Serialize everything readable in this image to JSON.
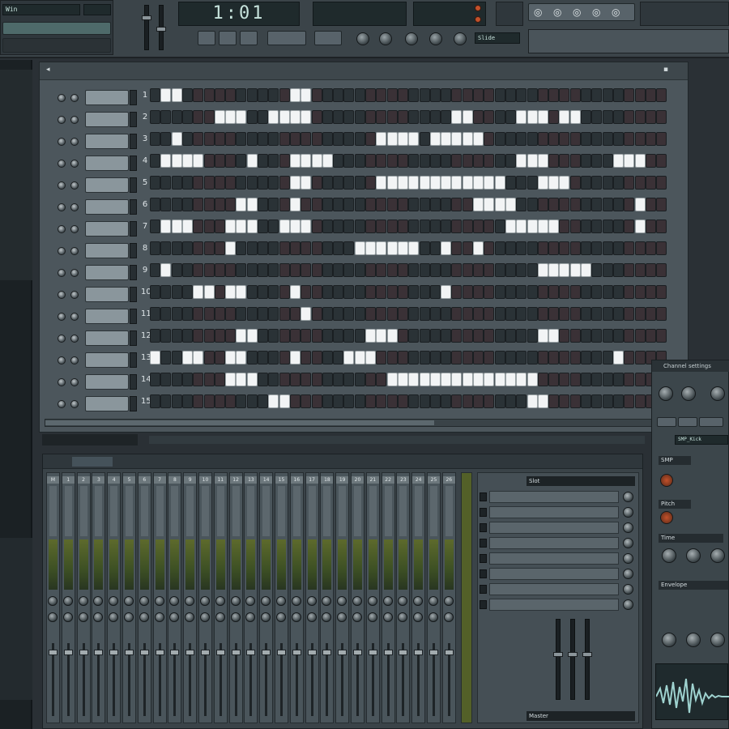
{
  "toolbar": {
    "song_title": "Win",
    "time_display": "1:01",
    "tempo_label": "",
    "pattern_label": "Slide"
  },
  "sequencer": {
    "channel_labels": [
      "",
      "",
      "",
      "",
      "",
      "",
      "",
      "",
      "",
      "",
      "",
      "",
      "",
      "",
      ""
    ],
    "rows": [
      {
        "idx": "1",
        "steps": [
          1,
          2,
          13,
          14
        ]
      },
      {
        "idx": "2",
        "steps": [
          6,
          7,
          8,
          11,
          12,
          13,
          14,
          28,
          29,
          34,
          35,
          36,
          38,
          39
        ]
      },
      {
        "idx": "3",
        "steps": [
          2,
          21,
          22,
          23,
          24,
          26,
          27,
          28,
          29,
          30
        ]
      },
      {
        "idx": "4",
        "steps": [
          1,
          2,
          3,
          4,
          9,
          13,
          14,
          15,
          16,
          34,
          35,
          36,
          43,
          44,
          45
        ]
      },
      {
        "idx": "5",
        "steps": [
          13,
          14,
          21,
          22,
          23,
          24,
          25,
          26,
          27,
          28,
          29,
          30,
          31,
          32,
          36,
          37,
          38
        ]
      },
      {
        "idx": "6",
        "steps": [
          8,
          9,
          13,
          30,
          31,
          32,
          33,
          45
        ]
      },
      {
        "idx": "7",
        "steps": [
          1,
          2,
          3,
          7,
          8,
          9,
          12,
          13,
          14,
          33,
          34,
          35,
          36,
          37,
          45
        ]
      },
      {
        "idx": "8",
        "steps": [
          7,
          19,
          20,
          21,
          22,
          23,
          24,
          27,
          30
        ]
      },
      {
        "idx": "9",
        "steps": [
          1,
          36,
          37,
          38,
          39,
          40
        ]
      },
      {
        "idx": "10",
        "steps": [
          4,
          5,
          7,
          8,
          13,
          27
        ]
      },
      {
        "idx": "11",
        "steps": [
          14
        ]
      },
      {
        "idx": "12",
        "steps": [
          8,
          9,
          20,
          21,
          22,
          36,
          37
        ]
      },
      {
        "idx": "13",
        "steps": [
          0,
          3,
          4,
          7,
          8,
          13,
          18,
          19,
          20,
          43
        ]
      },
      {
        "idx": "14",
        "steps": [
          7,
          8,
          9,
          22,
          23,
          24,
          25,
          26,
          27,
          28,
          29,
          30,
          31,
          32,
          33,
          34,
          35
        ]
      },
      {
        "idx": "15",
        "steps": [
          11,
          12,
          35,
          36
        ]
      }
    ]
  },
  "mixer": {
    "tabs": [
      "",
      "",
      ""
    ],
    "channels": [
      "M",
      "1",
      "2",
      "3",
      "4",
      "5",
      "6",
      "7",
      "8",
      "9",
      "10",
      "11",
      "12",
      "13",
      "14",
      "15",
      "16",
      "17",
      "18",
      "19",
      "20",
      "21",
      "22",
      "23",
      "24",
      "25",
      "26"
    ],
    "fx_header": "Slot",
    "fx_footer": "Master"
  },
  "channel_settings": {
    "title": "Channel settings",
    "labels": [
      "SMP",
      "Pitch",
      "Time",
      "Envelope"
    ],
    "name_field": "SMP_Kick"
  },
  "colors": {
    "step_on": "#f2f4f5",
    "step_off": "#2a3236",
    "meter_green": "#5d6a2c"
  }
}
